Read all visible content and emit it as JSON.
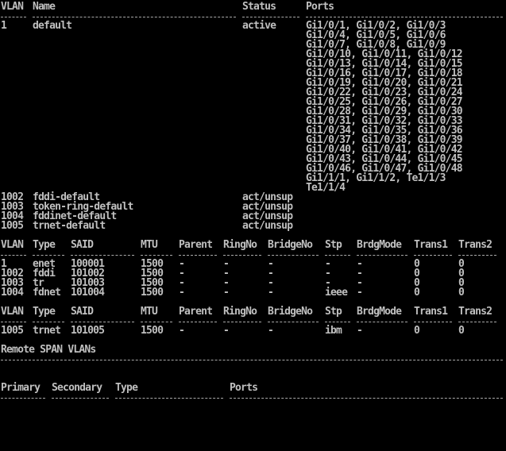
{
  "vlan_brief": {
    "headers": [
      "VLAN",
      "Name",
      "Status",
      "Ports"
    ],
    "rows": [
      {
        "vlan": "1",
        "name": "default",
        "status": "active",
        "ports": [
          "Gi1/0/1, Gi1/0/2, Gi1/0/3",
          "Gi1/0/4, Gi1/0/5, Gi1/0/6",
          "Gi1/0/7, Gi1/0/8, Gi1/0/9",
          "Gi1/0/10, Gi1/0/11, Gi1/0/12",
          "Gi1/0/13, Gi1/0/14, Gi1/0/15",
          "Gi1/0/16, Gi1/0/17, Gi1/0/18",
          "Gi1/0/19, Gi1/0/20, Gi1/0/21",
          "Gi1/0/22, Gi1/0/23, Gi1/0/24",
          "Gi1/0/25, Gi1/0/26, Gi1/0/27",
          "Gi1/0/28, Gi1/0/29, Gi1/0/30",
          "Gi1/0/31, Gi1/0/32, Gi1/0/33",
          "Gi1/0/34, Gi1/0/35, Gi1/0/36",
          "Gi1/0/37, Gi1/0/38, Gi1/0/39",
          "Gi1/0/40, Gi1/0/41, Gi1/0/42",
          "Gi1/0/43, Gi1/0/44, Gi1/0/45",
          "Gi1/0/46, Gi1/0/47, Gi1/0/48",
          "Gi1/1/1, Gi1/1/2, Te1/1/3",
          "Te1/1/4"
        ]
      },
      {
        "vlan": "1002",
        "name": "fddi-default",
        "status": "act/unsup",
        "ports": []
      },
      {
        "vlan": "1003",
        "name": "token-ring-default",
        "status": "act/unsup",
        "ports": []
      },
      {
        "vlan": "1004",
        "name": "fddinet-default",
        "status": "act/unsup",
        "ports": []
      },
      {
        "vlan": "1005",
        "name": "trnet-default",
        "status": "act/unsup",
        "ports": []
      }
    ]
  },
  "vlan_detail": {
    "headers": [
      "VLAN",
      "Type",
      "SAID",
      "MTU",
      "Parent",
      "RingNo",
      "BridgeNo",
      "Stp",
      "BrdgMode",
      "Trans1",
      "Trans2"
    ],
    "rows": [
      [
        "1",
        "enet",
        "100001",
        "1500",
        "-",
        "-",
        "-",
        "-",
        "-",
        "0",
        "0"
      ],
      [
        "1002",
        "fddi",
        "101002",
        "1500",
        "-",
        "-",
        "-",
        "-",
        "-",
        "0",
        "0"
      ],
      [
        "1003",
        "tr",
        "101003",
        "1500",
        "-",
        "-",
        "-",
        "-",
        "-",
        "0",
        "0"
      ],
      [
        "1004",
        "fdnet",
        "101004",
        "1500",
        "-",
        "-",
        "-",
        "ieee",
        "-",
        "0",
        "0"
      ]
    ]
  },
  "vlan_detail_2": {
    "headers": [
      "VLAN",
      "Type",
      "SAID",
      "MTU",
      "Parent",
      "RingNo",
      "BridgeNo",
      "Stp",
      "BrdgMode",
      "Trans1",
      "Trans2"
    ],
    "rows": [
      [
        "1005",
        "trnet",
        "101005",
        "1500",
        "-",
        "-",
        "-",
        "ibm",
        "-",
        "0",
        "0"
      ]
    ]
  },
  "remote_span": {
    "title": "Remote SPAN VLANs"
  },
  "private_vlan": {
    "headers": [
      "Primary",
      "Secondary",
      "Type",
      "Ports"
    ]
  }
}
